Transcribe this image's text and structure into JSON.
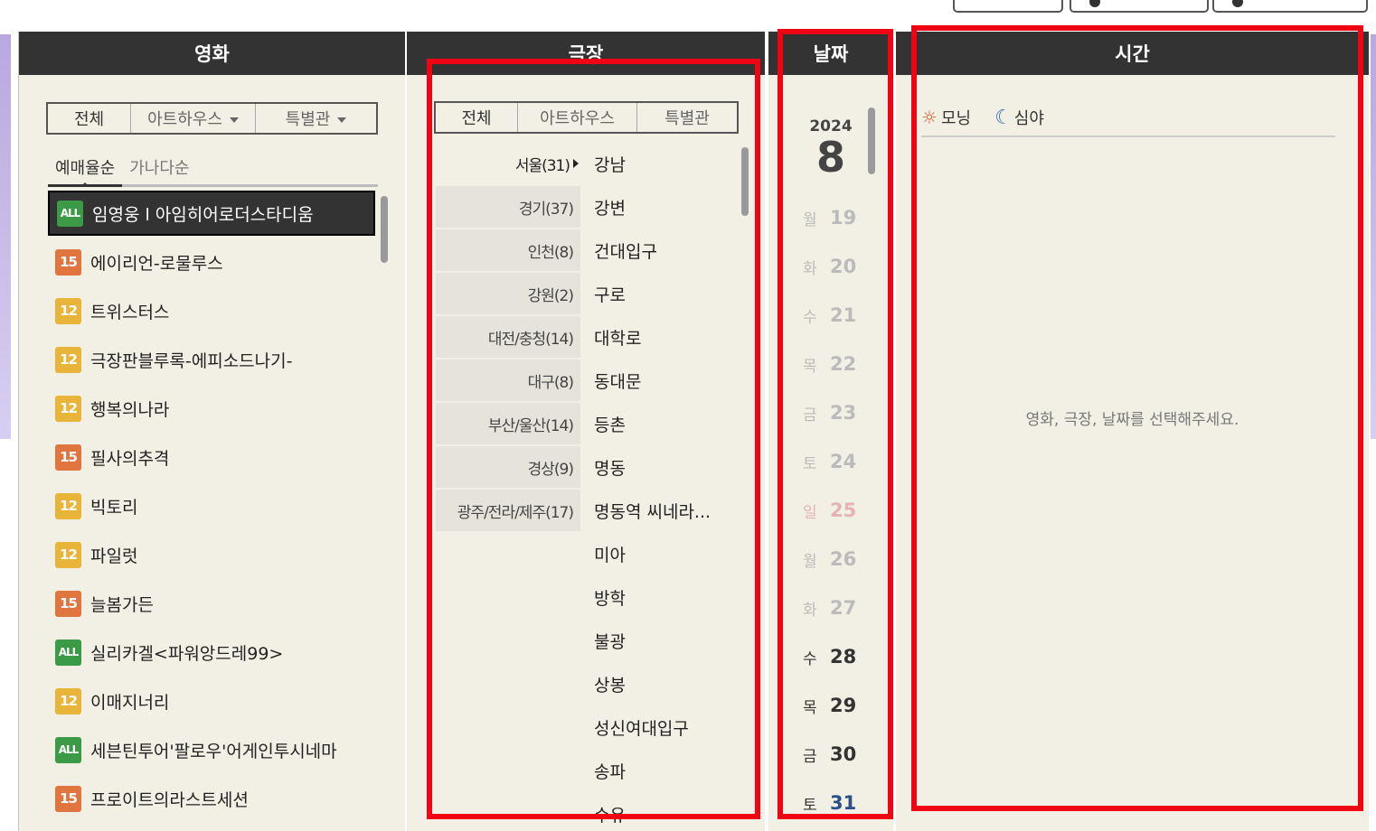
{
  "columns": {
    "movie": "영화",
    "theater": "극장",
    "date": "날짜",
    "time": "시간"
  },
  "movie_tabs": [
    {
      "label": "전체"
    },
    {
      "label": "아트하우스"
    },
    {
      "label": "특별관"
    }
  ],
  "sort_options": [
    "예매율순",
    "가나다순"
  ],
  "movies": [
    {
      "rating": "ALL",
      "title": "임영웅 l 아임히어로더스타디움",
      "selected": true
    },
    {
      "rating": "15",
      "title": "에이리언-로물루스"
    },
    {
      "rating": "12",
      "title": "트위스터스"
    },
    {
      "rating": "12",
      "title": "극장판블루록-에피소드나기-"
    },
    {
      "rating": "12",
      "title": "행복의나라"
    },
    {
      "rating": "15",
      "title": "필사의추격"
    },
    {
      "rating": "12",
      "title": "빅토리"
    },
    {
      "rating": "12",
      "title": "파일럿"
    },
    {
      "rating": "15",
      "title": "늘봄가든"
    },
    {
      "rating": "ALL",
      "title": "실리카겔<파워앙드레99>"
    },
    {
      "rating": "12",
      "title": "이매지너리"
    },
    {
      "rating": "ALL",
      "title": "세븐틴투어'팔로우'어게인투시네마"
    },
    {
      "rating": "15",
      "title": "프로이트의라스트세션"
    }
  ],
  "theater_tabs": [
    {
      "label": "전체"
    },
    {
      "label": "아트하우스"
    },
    {
      "label": "특별관"
    }
  ],
  "regions": [
    "서울(31)",
    "경기(37)",
    "인천(8)",
    "강원(2)",
    "대전/충청(14)",
    "대구(8)",
    "부산/울산(14)",
    "경상(9)",
    "광주/전라/제주(17)"
  ],
  "theaters": [
    "강남",
    "강변",
    "건대입구",
    "구로",
    "대학로",
    "동대문",
    "등촌",
    "명동",
    "명동역 씨네라...",
    "미아",
    "방학",
    "불광",
    "상봉",
    "성신여대입구",
    "송파",
    "수유"
  ],
  "date": {
    "year": "2024",
    "month": "8",
    "days": [
      {
        "wd": "월",
        "d": "19",
        "state": "off"
      },
      {
        "wd": "화",
        "d": "20",
        "state": "off"
      },
      {
        "wd": "수",
        "d": "21",
        "state": "off"
      },
      {
        "wd": "목",
        "d": "22",
        "state": "off"
      },
      {
        "wd": "금",
        "d": "23",
        "state": "off"
      },
      {
        "wd": "토",
        "d": "24",
        "state": "off"
      },
      {
        "wd": "일",
        "d": "25",
        "state": "sun"
      },
      {
        "wd": "월",
        "d": "26",
        "state": "off"
      },
      {
        "wd": "화",
        "d": "27",
        "state": "off"
      },
      {
        "wd": "수",
        "d": "28",
        "state": "avail"
      },
      {
        "wd": "목",
        "d": "29",
        "state": "avail"
      },
      {
        "wd": "금",
        "d": "30",
        "state": "avail"
      },
      {
        "wd": "토",
        "d": "31",
        "state": "sat"
      }
    ]
  },
  "time": {
    "morning": "모닝",
    "night": "심야",
    "message": "영화, 극장, 날짜를 선택해주세요."
  },
  "colors": {
    "header_bg": "#333333",
    "panel_bg": "#f2f0e5",
    "highlight": "#f00313"
  }
}
